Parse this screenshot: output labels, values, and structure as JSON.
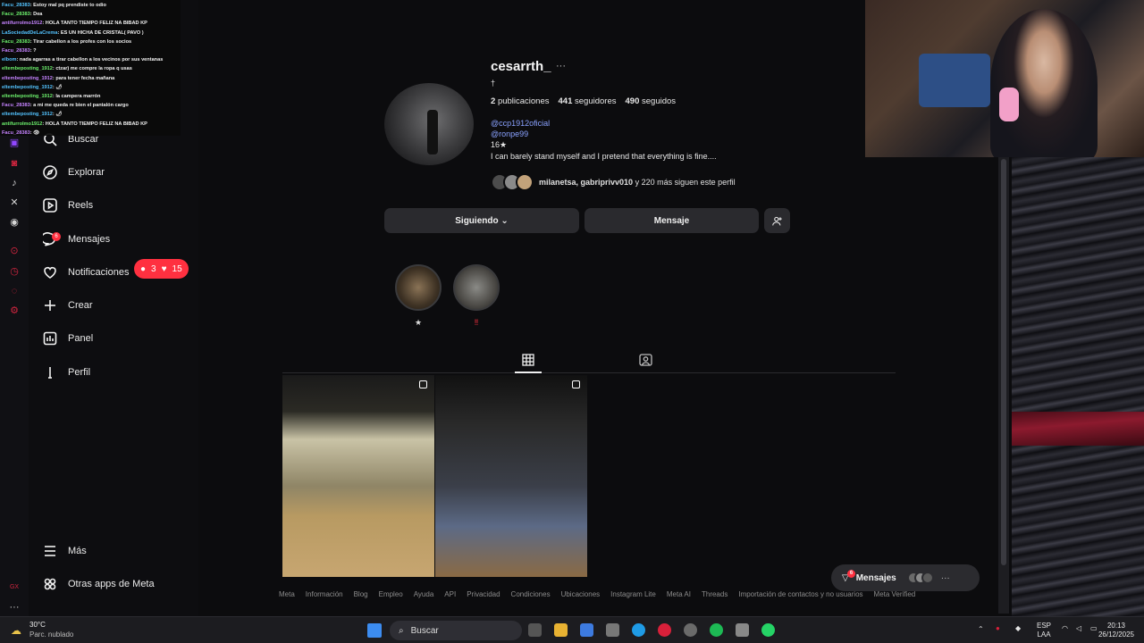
{
  "chat": {
    "messages": [
      {
        "user": "Facu_28383",
        "text": ": Estoy mal pq prendiste to odio"
      },
      {
        "user": "Facu_28383",
        "text": ": Dea"
      },
      {
        "user": "antifurrolmo1912",
        "text": ": HOLA TANTO TIEMPO FELIZ NA BIBAD KP"
      },
      {
        "user": "LaSociedadDeLaCrema",
        "text": ": ES UN HICHA DE CRISTAL( PAVO )"
      },
      {
        "user": "Facu_28383",
        "text": ": Tirar cabellon a los profes con los socios"
      },
      {
        "user": "Facu_28383",
        "text": ": ?"
      },
      {
        "user": "elbom",
        "text": ": nada agarras a tirar cabellon a los vecinos por sus ventanas"
      },
      {
        "user": "eltembeposting_1912",
        "text": ": ctzar) me compre la ropa q usas"
      },
      {
        "user": "eltembeposting_1912",
        "text": ": para tener fecha mañana"
      },
      {
        "user": "eltembeposting_1912",
        "text": ": 🌶"
      },
      {
        "user": "eltembeposting_1912",
        "text": ": la campera marrón"
      },
      {
        "user": "Facu_28383",
        "text": ": a mi me queda re bien el pantalón cargo"
      },
      {
        "user": "eltembeposting_1912",
        "text": ": 🌶"
      },
      {
        "user": "antifurrolmo1912",
        "text": ": HOLA TANTO TIEMPO FELIZ NA BIBAD KP"
      },
      {
        "user": "Facu_28383",
        "text": ": 👁"
      }
    ]
  },
  "nav": {
    "items": [
      {
        "label": "Buscar",
        "icon": "search-icon"
      },
      {
        "label": "Explorar",
        "icon": "compass-icon"
      },
      {
        "label": "Reels",
        "icon": "reels-icon"
      },
      {
        "label": "Mensajes",
        "icon": "messenger-icon",
        "badge": "6"
      },
      {
        "label": "Notificaciones",
        "icon": "heart-icon"
      },
      {
        "label": "Crear",
        "icon": "plus-icon"
      },
      {
        "label": "Panel",
        "icon": "chart-icon"
      },
      {
        "label": "Perfil",
        "icon": "avatar-icon"
      }
    ],
    "notifications_pill": {
      "comments": "3",
      "likes": "15"
    },
    "more_label": "Más",
    "meta_label": "Otras apps de Meta"
  },
  "profile": {
    "username": "cesarrth_",
    "more": "···",
    "bio_symbol": "†",
    "publications_count": "2",
    "publications_label": "publicaciones",
    "followers_count": "441",
    "followers_label": "seguidores",
    "following_count": "490",
    "following_label": "seguidos",
    "link1": "@ccp1912oficial",
    "link2": "@ronpe99",
    "bio_line1": "16★",
    "bio_line2": "I can barely stand myself and I pretend that everything is fine....",
    "followed_by": "milanetsa, gabriprivv010",
    "followed_by_rest": "y 220 más siguen este perfil",
    "btn_following": "Siguiendo ⌄",
    "btn_message": "Mensaje",
    "btn_suggest": "+",
    "highlights": [
      {
        "caption": "★"
      },
      {
        "caption": "‼"
      }
    ]
  },
  "footer": {
    "links": [
      "Meta",
      "Información",
      "Blog",
      "Empleo",
      "Ayuda",
      "API",
      "Privacidad",
      "Condiciones",
      "Ubicaciones",
      "Instagram Lite",
      "Meta AI",
      "Threads",
      "Importación de contactos y no usuarios",
      "Meta Verified"
    ]
  },
  "messages_pill": {
    "label": "Mensajes",
    "badge": "6",
    "more": "···"
  },
  "taskbar": {
    "weather_temp": "30°C",
    "weather_desc": "Parc. nublado",
    "search_label": "Buscar",
    "lang_top": "ESP",
    "lang_bottom": "LAA",
    "time": "20:13",
    "date": "26/12/2025"
  },
  "colors": {
    "accent_red": "#ff3040",
    "link_blue": "#8aa2ff",
    "bg": "#0c0c0e"
  }
}
